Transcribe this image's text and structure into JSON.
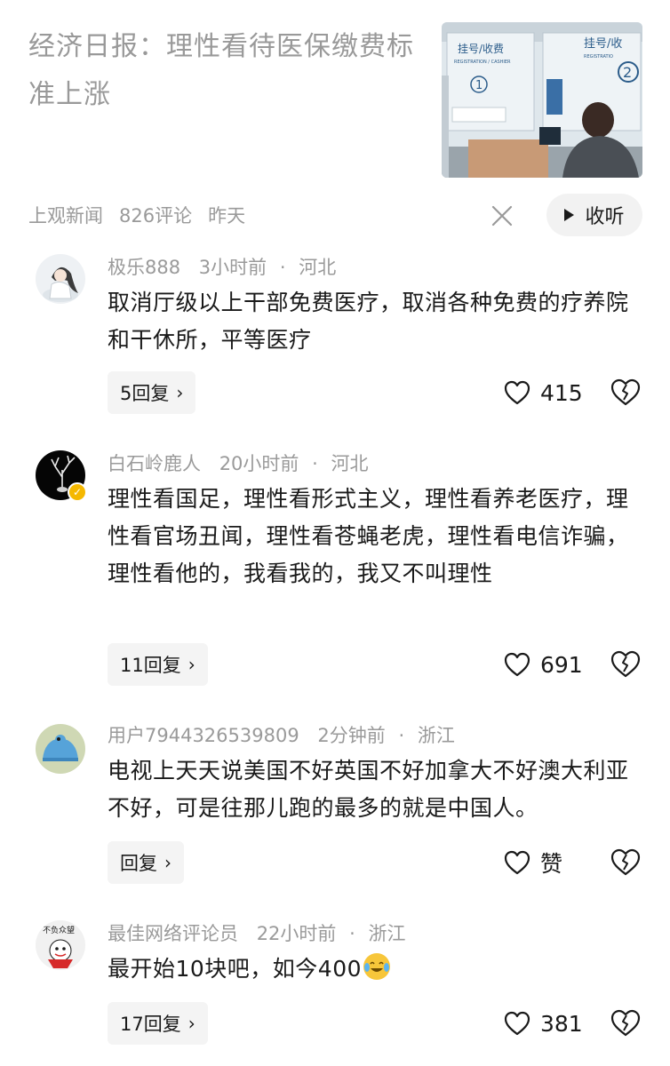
{
  "article": {
    "title": "经济日报：理性看待医保缴费标准上涨",
    "source": "上观新闻",
    "comment_count": "826评论",
    "time": "昨天",
    "listen_label": "收听"
  },
  "thumbnail": {
    "sign_left": "挂号/收费",
    "sign_left_en": "REGISTRATION / CASHIER",
    "sign_right": "挂号/收",
    "sign_right_en": "REGISTRATIO",
    "num_left": "1",
    "num_right": "2"
  },
  "comments": [
    {
      "user": "极乐888",
      "time": "3小时前",
      "location": "河北",
      "text": "取消厅级以上干部免费医疗，取消各种免费的疗养院和干休所，平等医疗",
      "reply_label": "5回复",
      "likes": "415"
    },
    {
      "user": "白石岭鹿人",
      "time": "20小时前",
      "location": "河北",
      "text": "理性看国足，理性看形式主义，理性看养老医疗，理性看官场丑闻，理性看苍蝇老虎，理性看电信诈骗，理性看他的，我看我的，我又不叫理性",
      "reply_label": "11回复",
      "likes": "691"
    },
    {
      "user": "用户7944326539809",
      "time": "2分钟前",
      "location": "浙江",
      "text": "电视上天天说美国不好英国不好加拿大不好澳大利亚不好，可是往那儿跑的最多的就是中国人。",
      "reply_label": "回复",
      "likes": "赞"
    },
    {
      "user": "最佳网络评论员",
      "time": "22小时前",
      "location": "浙江",
      "text": "最开始10块吧，如今400",
      "reply_label": "17回复",
      "likes": "381",
      "avatar_text": "不负众望"
    }
  ],
  "separator": "·",
  "chevron": "›",
  "colors": {
    "muted": "#9a9a9a",
    "text": "#1a1a1a",
    "button_bg": "#f4f4f4",
    "verified": "#f5b800"
  }
}
